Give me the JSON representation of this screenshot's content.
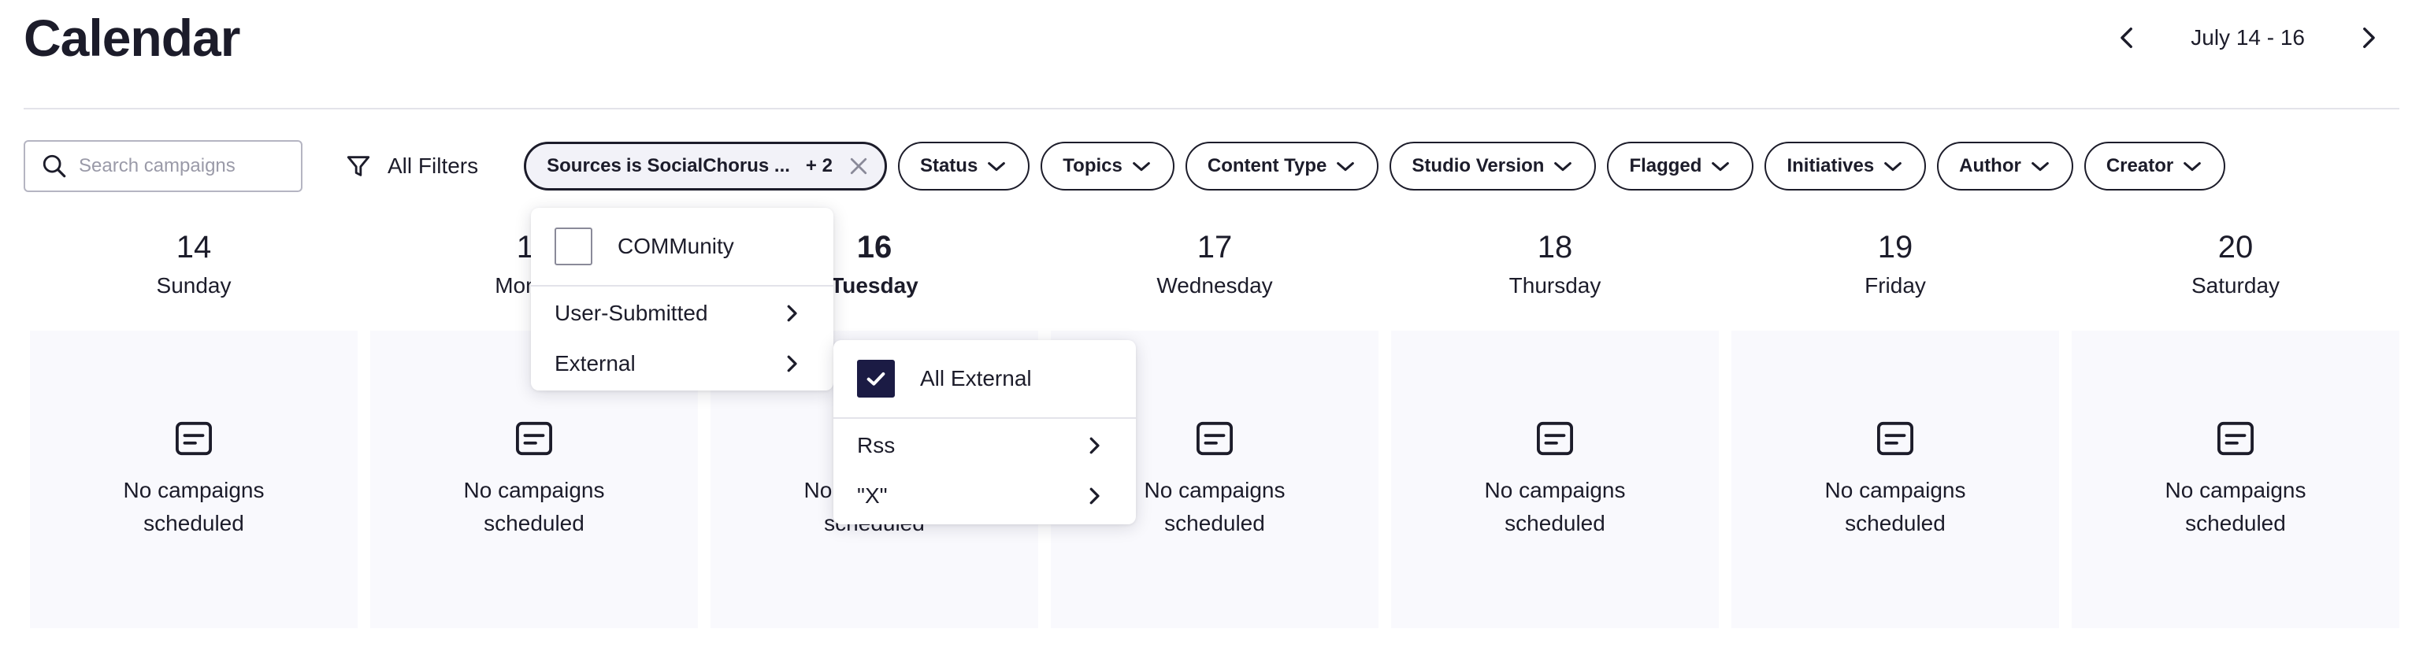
{
  "header": {
    "title": "Calendar",
    "date_range": "July 14 - 16"
  },
  "filters": {
    "search_placeholder": "Search campaigns",
    "all_filters_label": "All Filters",
    "sources_chip": {
      "key": "Sources",
      "value": "is SocialChorus ...",
      "extra": "+ 2"
    },
    "chips": [
      {
        "label": "Status"
      },
      {
        "label": "Topics"
      },
      {
        "label": "Content Type"
      },
      {
        "label": "Studio Version"
      },
      {
        "label": "Flagged"
      },
      {
        "label": "Initiatives"
      },
      {
        "label": "Author"
      },
      {
        "label": "Creator"
      }
    ]
  },
  "days": [
    {
      "num": "14",
      "name": "Sunday",
      "empty": "No campaigns scheduled"
    },
    {
      "num": "15",
      "name": "Monday",
      "empty": "No campaigns scheduled"
    },
    {
      "num": "16",
      "name": "Tuesday",
      "empty": "No campaigns scheduled"
    },
    {
      "num": "17",
      "name": "Wednesday",
      "empty": "No campaigns scheduled"
    },
    {
      "num": "18",
      "name": "Thursday",
      "empty": "No campaigns scheduled"
    },
    {
      "num": "19",
      "name": "Friday",
      "empty": "No campaigns scheduled"
    },
    {
      "num": "20",
      "name": "Saturday",
      "empty": "No campaigns scheduled"
    }
  ],
  "sources_dropdown": {
    "check_item": {
      "label": "COMMunity",
      "checked": false
    },
    "items": [
      {
        "label": "User-Submitted"
      },
      {
        "label": "External"
      }
    ]
  },
  "external_dropdown": {
    "check_item": {
      "label": "All External",
      "checked": true
    },
    "items": [
      {
        "label": "Rss"
      },
      {
        "label": "\"X\""
      }
    ]
  },
  "colors": {
    "text": "#1c1c2a",
    "check_fill": "#1b1b44",
    "cell_bg": "#f9f9fd",
    "divider": "#e3e3ea"
  }
}
